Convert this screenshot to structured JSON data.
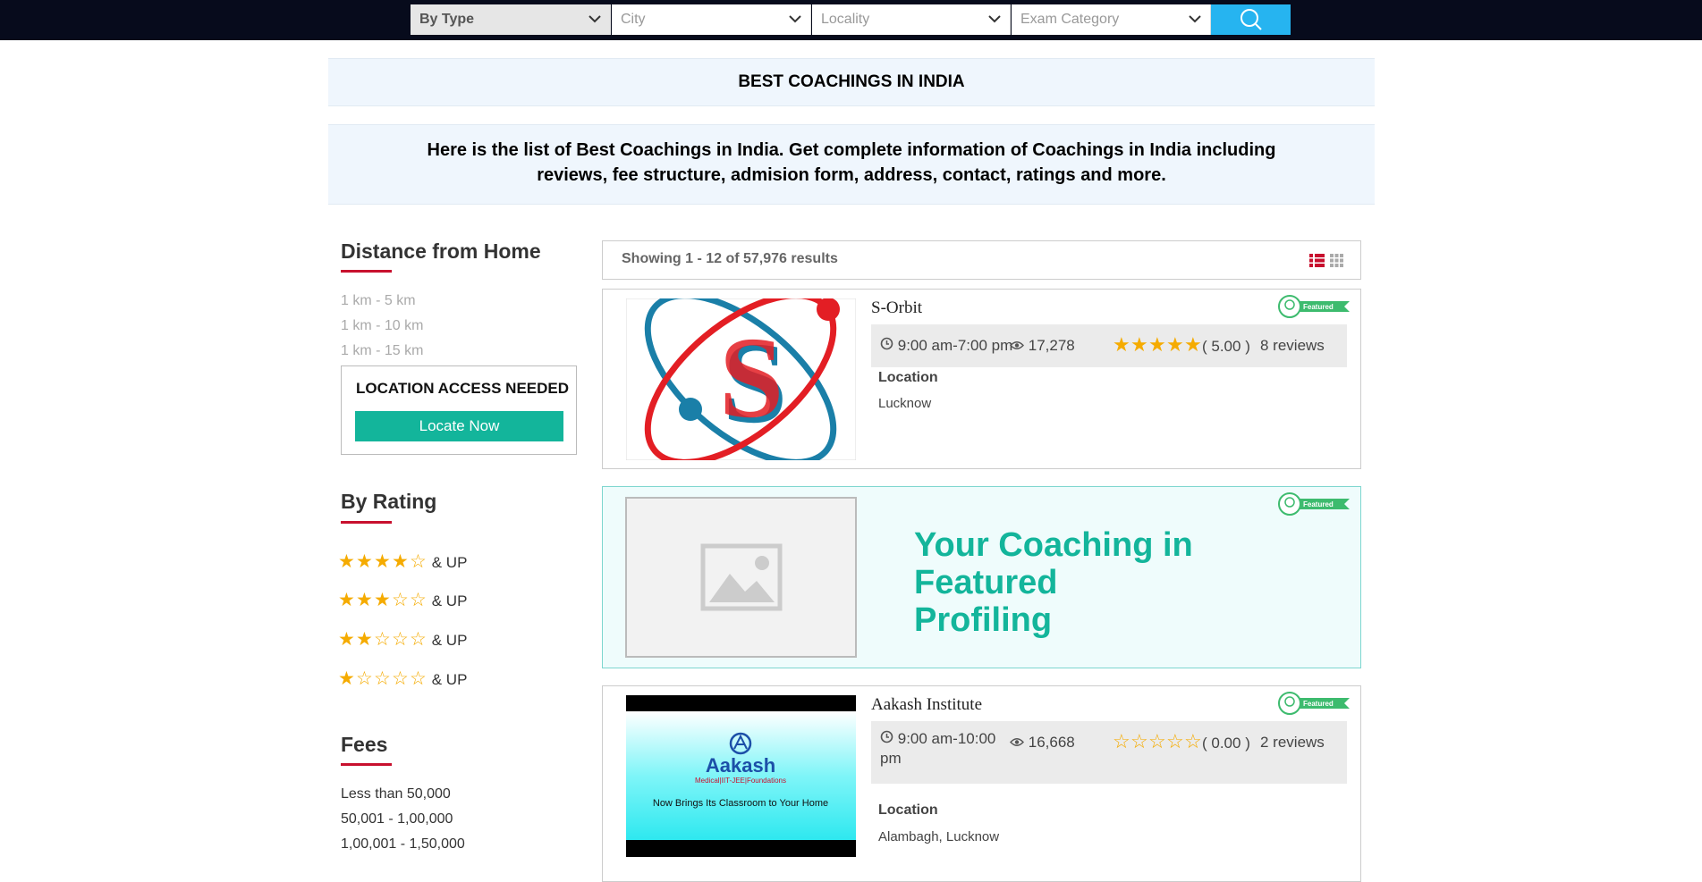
{
  "search": {
    "by_type": "By Type",
    "city": "City",
    "locality": "Locality",
    "exam_category": "Exam Category"
  },
  "page": {
    "title": "BEST COACHINGS IN INDIA",
    "intro": "Here is the list of Best Coachings in India. Get complete information of Coachings in India including reviews, fee structure, admision form, address, contact, ratings and more."
  },
  "sidebar": {
    "distance": {
      "heading": "Distance from Home",
      "options": [
        "1 km - 5 km",
        "1 km - 10 km",
        "1 km - 15 km"
      ],
      "location_box": {
        "title": "LOCATION ACCESS NEEDED",
        "button": "Locate Now"
      }
    },
    "rating": {
      "heading": "By Rating",
      "suffix": "& UP",
      "levels": [
        4,
        3,
        2,
        1
      ]
    },
    "fees": {
      "heading": "Fees",
      "options": [
        "Less than 50,000",
        "50,001 - 1,00,000",
        "1,00,001 - 1,50,000"
      ]
    }
  },
  "results": {
    "summary": "Showing 1 - 12 of 57,976 results"
  },
  "badge_label": "Featured",
  "listings": [
    {
      "name": "S-Orbit",
      "time": "9:00 am-7:00 pm",
      "views": "17,278",
      "rating": 5,
      "rating_text": "( 5.00 )",
      "reviews": "8 reviews",
      "location_label": "Location",
      "location": "Lucknow"
    },
    {
      "name": "Aakash Institute",
      "time_line1": "9:00 am-10:00",
      "time_line2": "pm",
      "views": "16,668",
      "rating": 0,
      "rating_text": "( 0.00 )",
      "reviews": "2 reviews",
      "location_label": "Location",
      "location": "Alambagh, Lucknow",
      "image_text": {
        "brand": "Aakash",
        "sub": "Medical|IIT-JEE|Foundations",
        "tagline": "Now Brings Its Classroom to Your Home"
      }
    }
  ],
  "promo": {
    "line1": "Your Coaching in Featured",
    "line2": "Profiling"
  },
  "colors": {
    "accent": "#13b59b",
    "star": "#f5ab00",
    "topbar": "#070b1c",
    "search": "#26b4f0"
  }
}
